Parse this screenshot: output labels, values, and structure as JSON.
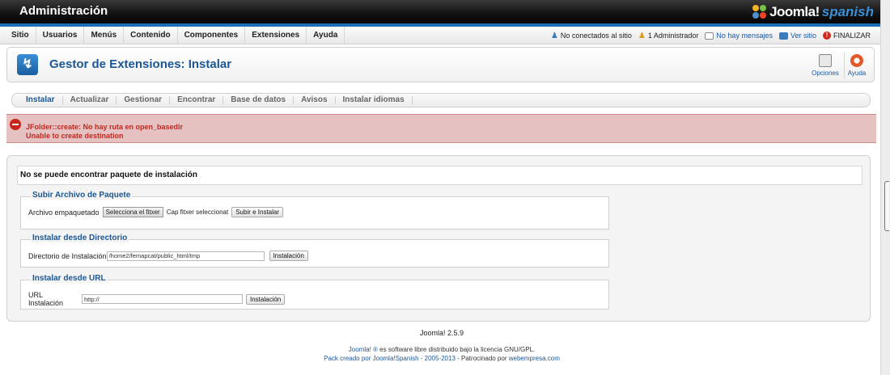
{
  "header": {
    "title": "Administración",
    "logo_a": "Joomla!",
    "logo_b": "spanish"
  },
  "menu": {
    "items": [
      {
        "label": "Sitio"
      },
      {
        "label": "Usuarios"
      },
      {
        "label": "Menús"
      },
      {
        "label": "Contenido"
      },
      {
        "label": "Componentes"
      },
      {
        "label": "Extensiones"
      },
      {
        "label": "Ayuda"
      }
    ]
  },
  "status": {
    "not_connected": "No conectados al sitio",
    "admins": "1 Administrador",
    "messages": "No hay mensajes",
    "view_site": "Ver sitio",
    "logout": "FINALIZAR"
  },
  "toolbar": {
    "title": "Gestor de Extensiones: Instalar",
    "options_label": "Opciones",
    "help_label": "Ayuda"
  },
  "tabs": [
    {
      "label": "Instalar",
      "active": true
    },
    {
      "label": "Actualizar"
    },
    {
      "label": "Gestionar"
    },
    {
      "label": "Encontrar"
    },
    {
      "label": "Base de datos"
    },
    {
      "label": "Avisos"
    },
    {
      "label": "Instalar idiomas"
    }
  ],
  "error": {
    "line1": "JFolder::create: No hay ruta en open_basedir",
    "line2": "Unable to create destination"
  },
  "notice": "No se puede encontrar paquete de instalación",
  "upload": {
    "legend": "Subir Archivo de Paquete",
    "label": "Archivo empaquetado",
    "choose_button": "Selecciona el fitxer",
    "no_file": "Cap fitxer seleccionat",
    "submit": "Subir e Instalar"
  },
  "directory": {
    "legend": "Instalar desde Directorio",
    "label": "Directorio de Instalación",
    "value": "/home2/femapcat/public_html/tmp",
    "submit": "Instalación"
  },
  "url": {
    "legend": "Instalar desde URL",
    "label": "URL Instalación",
    "value": "http://",
    "submit": "Instalación"
  },
  "footer": {
    "version": "Joomla! 2.5.9",
    "line1_link": "Joomla! ®",
    "line1_text": " es software libre distribuido bajo la licencia GNU/GPL.",
    "line2_link1": "Pack creado por Joomla!Spanish - 2005-2013",
    "line2_text": " - Patrocinado por ",
    "line2_link2": "webempresa.com"
  },
  "colors": {
    "accent": "#1b5796",
    "error_bg": "#e6c1c1",
    "error_text": "#c1271d",
    "header_bg": "#111111"
  }
}
